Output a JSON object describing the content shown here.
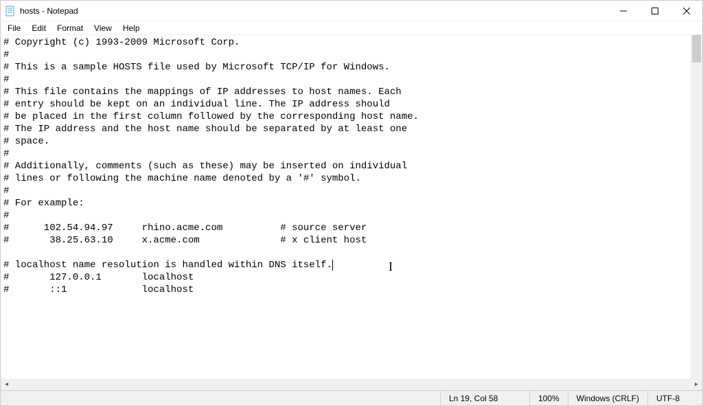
{
  "window": {
    "title": "hosts - Notepad"
  },
  "menu": {
    "items": [
      "File",
      "Edit",
      "Format",
      "View",
      "Help"
    ]
  },
  "editor": {
    "lines": [
      "# Copyright (c) 1993-2009 Microsoft Corp.",
      "#",
      "# This is a sample HOSTS file used by Microsoft TCP/IP for Windows.",
      "#",
      "# This file contains the mappings of IP addresses to host names. Each",
      "# entry should be kept on an individual line. The IP address should",
      "# be placed in the first column followed by the corresponding host name.",
      "# The IP address and the host name should be separated by at least one",
      "# space.",
      "#",
      "# Additionally, comments (such as these) may be inserted on individual",
      "# lines or following the machine name denoted by a '#' symbol.",
      "#",
      "# For example:",
      "#",
      "#      102.54.94.97     rhino.acme.com          # source server",
      "#       38.25.63.10     x.acme.com              # x client host",
      "",
      "# localhost name resolution is handled within DNS itself.",
      "#       127.0.0.1       localhost",
      "#       ::1             localhost"
    ],
    "caret_line_index": 18
  },
  "status": {
    "position": "Ln 19, Col 58",
    "zoom": "100%",
    "line_ending": "Windows (CRLF)",
    "encoding": "UTF-8"
  }
}
